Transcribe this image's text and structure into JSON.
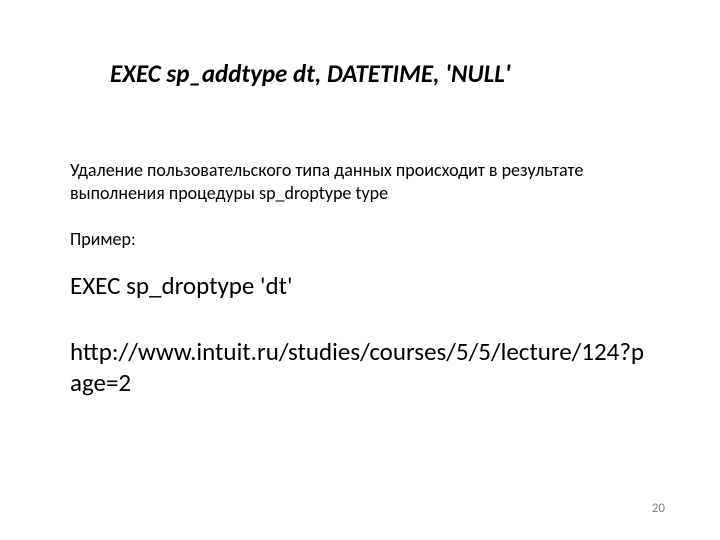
{
  "title": "EXEC sp_addtype dt, DATETIME, 'NULL'",
  "paragraph": "Удаление пользовательского типа данных происходит в результате выполнения процедуры sp_droptype type",
  "example_label": "Пример:",
  "code": "EXEC sp_droptype 'dt'",
  "url": "http://www.intuit.ru/studies/courses/5/5/lecture/124?page=2",
  "page_number": "20"
}
